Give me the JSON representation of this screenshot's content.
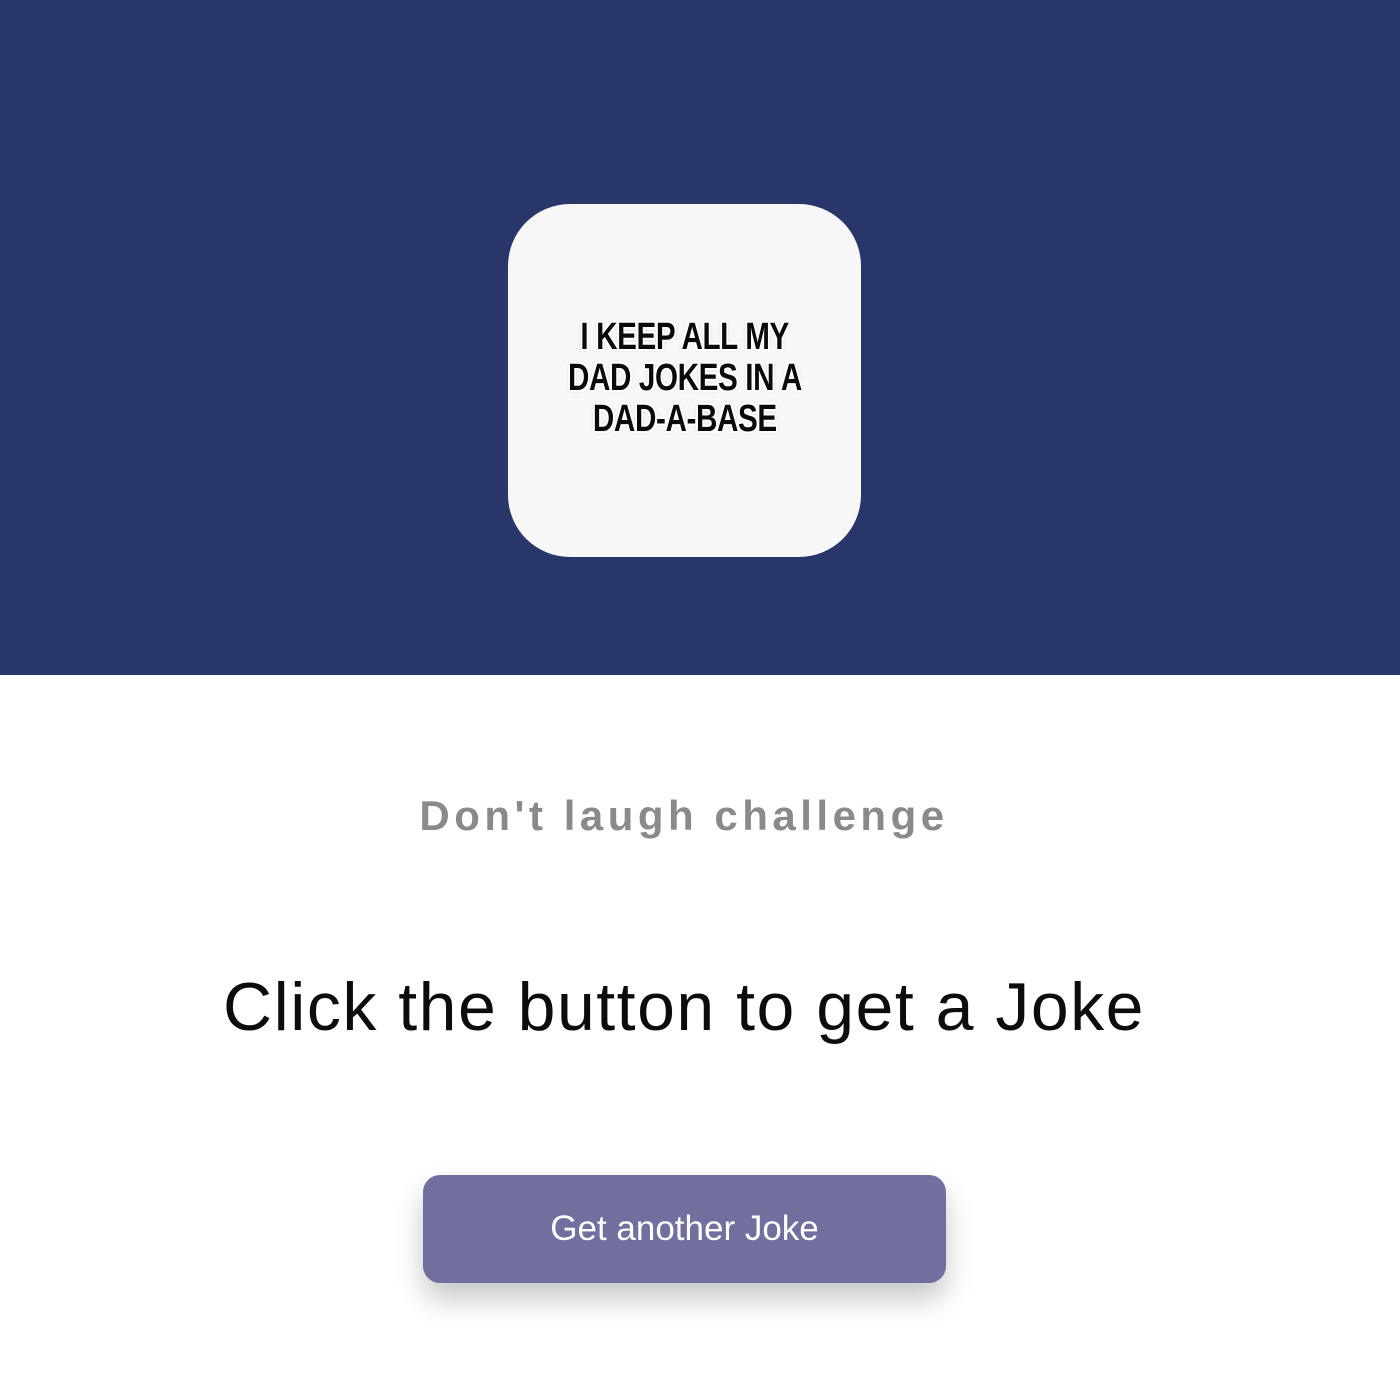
{
  "colors": {
    "hero_background": "#29366a",
    "logo_card_background": "#f7f7f7",
    "subtitle_text": "#8a8a8a",
    "button_background": "#706f9e",
    "button_text": "#ffffff"
  },
  "logo": {
    "lines": [
      "I KEEP ALL MY",
      "DAD JOKES IN A",
      "DAD-A-BASE"
    ]
  },
  "main": {
    "subtitle": "Don't laugh challenge",
    "joke_text": "Click the button to get a Joke",
    "button_label": "Get another Joke"
  }
}
